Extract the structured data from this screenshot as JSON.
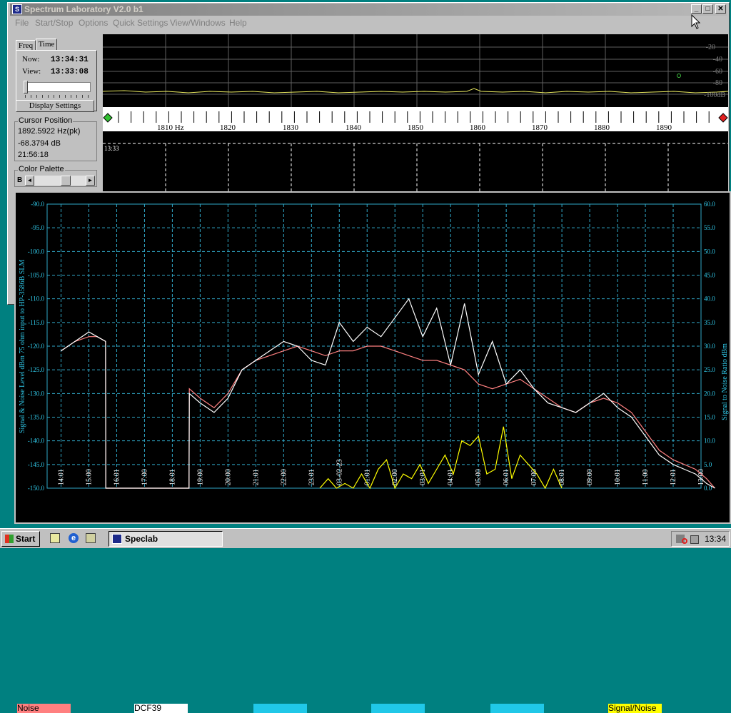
{
  "window": {
    "title": "Spectrum Laboratory V2.0 b1",
    "minimize": "_",
    "maximize": "□",
    "close": "✕"
  },
  "menu": [
    "File",
    "Start/Stop",
    "Options",
    "Quick Settings",
    "View/Windows",
    "Help"
  ],
  "left_panel": {
    "tabs": [
      "Freq",
      "Time"
    ],
    "active_tab": "Time",
    "now_label": "Now:",
    "now_value": "13:34:31",
    "view_label": "View:",
    "view_value": "13:33:08",
    "display_settings": "Display Settings",
    "cursor_group": "Cursor Position",
    "cursor_freq": "1892.5922 Hz(pk)",
    "cursor_level": "-68.3794 dB",
    "cursor_time": "21:56:18",
    "palette_group": "Color Palette",
    "palette_prefix": "B",
    "scroll_left": "◄",
    "scroll_right": "►"
  },
  "spectrum": {
    "db_ticks": [
      "-20",
      "-40",
      "-60",
      "-80",
      "-100dB"
    ],
    "freq_ticks": [
      "1810 Hz",
      "1820",
      "1830",
      "1840",
      "1850",
      "1860",
      "1870",
      "1880",
      "1890"
    ],
    "waterfall_time": "13:33"
  },
  "chart_data": {
    "type": "line",
    "ylabel": "Signal & Noise Level dBm 75 ohm input to HP-3586B SLM",
    "y2label": "Signal to Noise Ratio dBm",
    "ylim": [
      -150,
      -90
    ],
    "y_ticks": [
      "-90.0",
      "-95.0",
      "-100.0",
      "-105.0",
      "-110.0",
      "-115.0",
      "-120.0",
      "-125.0",
      "-130.0",
      "-135.0",
      "-140.0",
      "-145.0",
      "-150.0"
    ],
    "y2lim": [
      0,
      60
    ],
    "y2_ticks": [
      "60.0",
      "55.0",
      "50.0",
      "45.0",
      "40.0",
      "35.0",
      "30.0",
      "25.0",
      "20.0",
      "15.0",
      "10.0",
      "5.0",
      "0.0"
    ],
    "x_ticks": [
      "14:01",
      "15:00",
      "16:01",
      "17:00",
      "18:01",
      "19:00",
      "20:00",
      "21:01",
      "22:00",
      "23:01",
      "03-02-23",
      "01:01",
      "02:00",
      "03:01",
      "04:01",
      "05:00",
      "06:01",
      "07:00",
      "08:01",
      "09:00",
      "10:01",
      "11:00",
      "12:01",
      "13:00"
    ],
    "grid": true,
    "series": [
      {
        "name": "Noise",
        "color": "#ff8080",
        "x": [
          0,
          0.5,
          1.0,
          1.3,
          1.6,
          1.61,
          4.6,
          4.61,
          5.0,
          5.5,
          6.0,
          6.5,
          7.0,
          7.5,
          8.0,
          8.5,
          9.0,
          9.5,
          10.0,
          10.5,
          11.0,
          11.5,
          12.0,
          12.5,
          13.0,
          13.5,
          14.0,
          14.5,
          15.0,
          15.5,
          16.0,
          16.5,
          17.0,
          17.5,
          18.0,
          18.5,
          19.0,
          19.5,
          20.0,
          20.5,
          21.0,
          21.5,
          22.0,
          22.4,
          22.8,
          23.2,
          23.5
        ],
        "y": [
          -121,
          -119,
          -118,
          -118,
          -119,
          -150,
          -150,
          -129,
          -131,
          -133,
          -130,
          -125,
          -123,
          -122,
          -121,
          -120,
          -121,
          -122,
          -121,
          -121,
          -120,
          -120,
          -121,
          -122,
          -123,
          -123,
          -124,
          -125,
          -128,
          -129,
          -128,
          -127,
          -129,
          -131,
          -133,
          -134,
          -132,
          -131,
          -132,
          -134,
          -138,
          -142,
          -144,
          -145,
          -146,
          -148,
          -150
        ]
      },
      {
        "name": "DCF39",
        "color": "#ffffff",
        "x": [
          0,
          0.5,
          1.0,
          1.3,
          1.6,
          1.61,
          4.6,
          4.61,
          5.0,
          5.5,
          6.0,
          6.5,
          7.0,
          7.5,
          8.0,
          8.5,
          9.0,
          9.5,
          10.0,
          10.5,
          11.0,
          11.5,
          12.0,
          12.5,
          13.0,
          13.5,
          14.0,
          14.5,
          15.0,
          15.5,
          16.0,
          16.5,
          17.0,
          17.5,
          18.0,
          18.5,
          19.0,
          19.5,
          20.0,
          20.5,
          21.0,
          21.5,
          22.0,
          22.4,
          22.8,
          23.2,
          23.5
        ],
        "y": [
          -121,
          -119,
          -117,
          -118,
          -119,
          -150,
          -150,
          -130,
          -132,
          -134,
          -131,
          -125,
          -123,
          -121,
          -119,
          -120,
          -123,
          -124,
          -115,
          -119,
          -116,
          -118,
          -114,
          -110,
          -118,
          -112,
          -124,
          -111,
          -126,
          -119,
          -128,
          -125,
          -129,
          -132,
          -133,
          -134,
          -132,
          -130,
          -133,
          -135,
          -139,
          -143,
          -145,
          -146,
          -147,
          -149,
          -150
        ]
      },
      {
        "name": "Signal/Noise",
        "color": "#ffff00",
        "x": [
          9.3,
          9.6,
          9.9,
          10.2,
          10.5,
          10.8,
          11.1,
          11.4,
          11.7,
          12.0,
          12.3,
          12.6,
          12.9,
          13.2,
          13.5,
          13.8,
          14.1,
          14.4,
          14.7,
          15.0,
          15.3,
          15.6,
          15.9,
          16.2,
          16.5,
          16.8,
          17.1,
          17.4,
          17.7,
          18.0
        ],
        "y": [
          0,
          2,
          0,
          1,
          0,
          3,
          0,
          4,
          6,
          0,
          3,
          2,
          5,
          1,
          4,
          7,
          3,
          10,
          9,
          11,
          3,
          4,
          13,
          2,
          7,
          5,
          3,
          0,
          4,
          0
        ]
      }
    ]
  },
  "legend": {
    "noise": "Noise",
    "dcf39": "DCF39",
    "snr": "Signal/Noise"
  },
  "taskbar": {
    "start": "Start",
    "app": "Speclab",
    "clock": "13:34"
  },
  "colors": {
    "grid": "#30a8c8",
    "noise": "#ff8080",
    "signal": "#ffffff",
    "snr": "#ffff00",
    "axis_label": "#30c8e8"
  }
}
